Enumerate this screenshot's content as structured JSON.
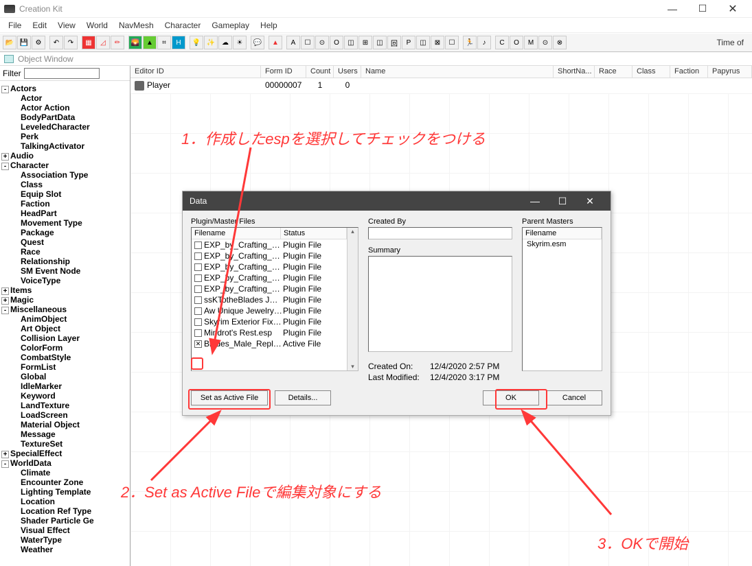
{
  "window": {
    "title": "Creation Kit",
    "min": "—",
    "max": "☐",
    "close": "✕"
  },
  "menu": [
    "File",
    "Edit",
    "View",
    "World",
    "NavMesh",
    "Character",
    "Gameplay",
    "Help"
  ],
  "toolbar": {
    "rightText": "Time of"
  },
  "objectWindow": {
    "title": "Object Window"
  },
  "filter": {
    "label": "Filter",
    "value": ""
  },
  "tree": [
    {
      "t": "Actors",
      "bold": true,
      "exp": "-",
      "pad": 0
    },
    {
      "t": "Actor",
      "bold": true,
      "pad": 2
    },
    {
      "t": "Actor Action",
      "bold": true,
      "pad": 2
    },
    {
      "t": "BodyPartData",
      "bold": true,
      "pad": 2
    },
    {
      "t": "LeveledCharacter",
      "bold": true,
      "pad": 2
    },
    {
      "t": "Perk",
      "bold": true,
      "pad": 2
    },
    {
      "t": "TalkingActivator",
      "bold": true,
      "pad": 2
    },
    {
      "t": "Audio",
      "bold": true,
      "exp": "+",
      "pad": 0
    },
    {
      "t": "Character",
      "bold": true,
      "exp": "-",
      "pad": 0
    },
    {
      "t": "Association Type",
      "bold": true,
      "pad": 2
    },
    {
      "t": "Class",
      "bold": true,
      "pad": 2
    },
    {
      "t": "Equip Slot",
      "bold": true,
      "pad": 2
    },
    {
      "t": "Faction",
      "bold": true,
      "pad": 2
    },
    {
      "t": "HeadPart",
      "bold": true,
      "pad": 2
    },
    {
      "t": "Movement Type",
      "bold": true,
      "pad": 2
    },
    {
      "t": "Package",
      "bold": true,
      "pad": 2
    },
    {
      "t": "Quest",
      "bold": true,
      "pad": 2
    },
    {
      "t": "Race",
      "bold": true,
      "pad": 2
    },
    {
      "t": "Relationship",
      "bold": true,
      "pad": 2
    },
    {
      "t": "SM Event Node",
      "bold": true,
      "pad": 2
    },
    {
      "t": "VoiceType",
      "bold": true,
      "pad": 2
    },
    {
      "t": "Items",
      "bold": true,
      "exp": "+",
      "pad": 0
    },
    {
      "t": "Magic",
      "bold": true,
      "exp": "+",
      "pad": 0
    },
    {
      "t": "Miscellaneous",
      "bold": true,
      "exp": "-",
      "pad": 0
    },
    {
      "t": "AnimObject",
      "bold": true,
      "pad": 2
    },
    {
      "t": "Art Object",
      "bold": true,
      "pad": 2
    },
    {
      "t": "Collision Layer",
      "bold": true,
      "pad": 2
    },
    {
      "t": "ColorForm",
      "bold": true,
      "pad": 2
    },
    {
      "t": "CombatStyle",
      "bold": true,
      "pad": 2
    },
    {
      "t": "FormList",
      "bold": true,
      "pad": 2
    },
    {
      "t": "Global",
      "bold": true,
      "pad": 2
    },
    {
      "t": "IdleMarker",
      "bold": true,
      "pad": 2
    },
    {
      "t": "Keyword",
      "bold": true,
      "pad": 2
    },
    {
      "t": "LandTexture",
      "bold": true,
      "pad": 2
    },
    {
      "t": "LoadScreen",
      "bold": true,
      "pad": 2
    },
    {
      "t": "Material Object",
      "bold": true,
      "pad": 2
    },
    {
      "t": "Message",
      "bold": true,
      "pad": 2
    },
    {
      "t": "TextureSet",
      "bold": true,
      "pad": 2
    },
    {
      "t": "SpecialEffect",
      "bold": true,
      "exp": "+",
      "pad": 0
    },
    {
      "t": "WorldData",
      "bold": true,
      "exp": "-",
      "pad": 0
    },
    {
      "t": "Climate",
      "bold": true,
      "pad": 2
    },
    {
      "t": "Encounter Zone",
      "bold": true,
      "pad": 2
    },
    {
      "t": "Lighting Template",
      "bold": true,
      "pad": 2
    },
    {
      "t": "Location",
      "bold": true,
      "pad": 2
    },
    {
      "t": "Location Ref Type",
      "bold": true,
      "pad": 2
    },
    {
      "t": "Shader Particle Ge",
      "bold": true,
      "pad": 2
    },
    {
      "t": "Visual Effect",
      "bold": true,
      "pad": 2
    },
    {
      "t": "WaterType",
      "bold": true,
      "pad": 2
    },
    {
      "t": "Weather",
      "bold": true,
      "pad": 2
    }
  ],
  "list": {
    "headers": {
      "EditorID": "Editor ID",
      "FormID": "Form ID",
      "Count": "Count",
      "Users": "Users",
      "Name": "Name",
      "ShortName": "ShortNa...",
      "Race": "Race",
      "Class": "Class",
      "Faction": "Faction",
      "Papyrus": "Papyrus"
    },
    "rows": [
      {
        "EditorID": "Player",
        "FormID": "00000007",
        "Count": "1",
        "Users": "0"
      }
    ]
  },
  "dialog": {
    "title": "Data",
    "pluginLabel": "Plugin/Master Files",
    "colFilename": "Filename",
    "colStatus": "Status",
    "plugins": [
      {
        "chk": false,
        "name": "EXP_by_Crafting_Tiny…",
        "status": "Plugin File"
      },
      {
        "chk": false,
        "name": "EXP_by_Crafting_Belk…",
        "status": "Plugin File"
      },
      {
        "chk": false,
        "name": "EXP_by_Crafting_Eatin…",
        "status": "Plugin File"
      },
      {
        "chk": false,
        "name": "EXP_by_Crafting_Vanil…",
        "status": "Plugin File"
      },
      {
        "chk": false,
        "name": "EXP_by_Crafting_Hear…",
        "status": "Plugin File"
      },
      {
        "chk": false,
        "name": "ssKTotheBlades JK D…",
        "status": "Plugin File"
      },
      {
        "chk": false,
        "name": "Aw Unique Jewelry…",
        "status": "Plugin File"
      },
      {
        "chk": false,
        "name": "Skyrim Exterior Fixes…",
        "status": "Plugin File"
      },
      {
        "chk": false,
        "name": "Mindrot's Rest.esp",
        "status": "Plugin File"
      },
      {
        "chk": true,
        "name": "Blades_Male_Replacer…",
        "status": "Active File"
      }
    ],
    "createdByLabel": "Created By",
    "createdBy": "",
    "summaryLabel": "Summary",
    "summary": "",
    "createdOnLabel": "Created On:",
    "createdOn": "12/4/2020  2:57 PM",
    "lastModLabel": "Last Modified:",
    "lastMod": "12/4/2020  3:17 PM",
    "parentLabel": "Parent Masters",
    "parentCol": "Filename",
    "parentMasters": [
      "Skyrim.esm"
    ],
    "btnSetActive": "Set as Active File",
    "btnDetails": "Details...",
    "btnOK": "OK",
    "btnCancel": "Cancel"
  },
  "annotations": {
    "a1": "1．作成したespを選択してチェックをつける",
    "a2": "2．Set as Active Fileで編集対象にする",
    "a3": "3．OKで開始"
  }
}
